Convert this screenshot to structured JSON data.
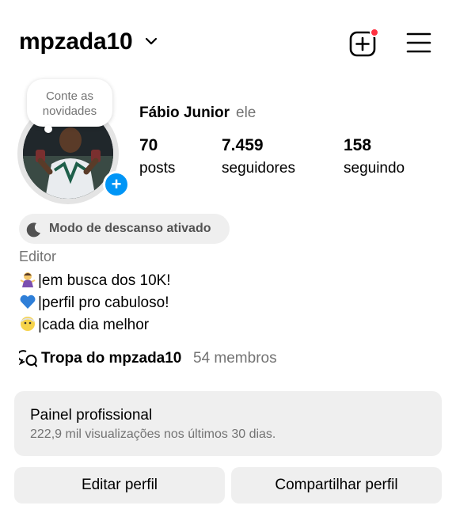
{
  "header": {
    "username": "mpzada10",
    "icons": [
      "chevron-down-icon",
      "add-post-icon",
      "menu-icon"
    ],
    "notification_color": "#ff3040"
  },
  "note": {
    "text_line1": "Conte as",
    "text_line2": "novidades"
  },
  "profile": {
    "full_name": "Fábio Junior",
    "pronoun": "ele",
    "stats": [
      {
        "value": "70",
        "label": "posts"
      },
      {
        "value": "7.459",
        "label": "seguidores"
      },
      {
        "value": "158",
        "label": "seguindo"
      }
    ]
  },
  "rest_mode": {
    "label": "Modo de descanso ativado",
    "icon": "moon-icon"
  },
  "bio": {
    "category": "Editor",
    "lines": [
      {
        "emoji": "woman-shrugging-emoji",
        "text": "|em busca dos 10K!"
      },
      {
        "emoji": "blue-heart-emoji",
        "text": "|perfil pro cabuloso!"
      },
      {
        "emoji": "face-emoji",
        "text": "|cada dia melhor"
      }
    ]
  },
  "community": {
    "icon": "chat-bubbles-icon",
    "name": "Tropa do mpzada10",
    "members": "54 membros"
  },
  "pro_dashboard": {
    "title": "Painel profissional",
    "subtitle": "222,9 mil visualizações nos últimos 30 dias."
  },
  "actions": {
    "edit_label": "Editar perfil",
    "share_label": "Compartilhar perfil"
  },
  "colors": {
    "accent": "#0095f6",
    "muted_text": "#737373",
    "panel_bg": "#efefef"
  }
}
